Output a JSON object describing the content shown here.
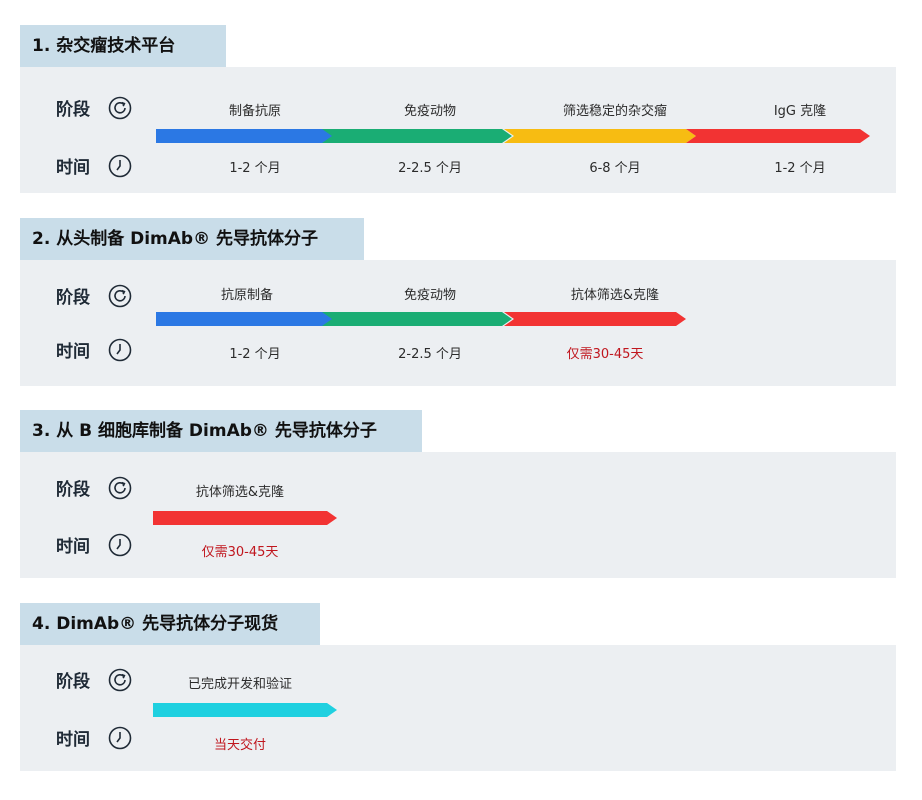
{
  "labels": {
    "stage": "阶段",
    "time": "时间"
  },
  "colors": {
    "blue": "#2b78e4",
    "green": "#1aad74",
    "yellow": "#f7bc12",
    "red": "#f23333",
    "cyan": "#1fd0e0",
    "highlight_text": "#c0161e"
  },
  "sections": [
    {
      "title": "1. 杂交瘤技术平台",
      "stages": [
        {
          "name": "制备抗原",
          "duration": "1-2 个月",
          "color": "blue"
        },
        {
          "name": "免疫动物",
          "duration": "2-2.5 个月",
          "color": "green"
        },
        {
          "name": "筛选稳定的杂交瘤",
          "duration": "6-8 个月",
          "color": "yellow"
        },
        {
          "name": "IgG 克隆",
          "duration": "1-2 个月",
          "color": "red"
        }
      ]
    },
    {
      "title": "2. 从头制备 DimAb® 先导抗体分子",
      "stages": [
        {
          "name": "抗原制备",
          "duration": "1-2 个月",
          "color": "blue"
        },
        {
          "name": "免疫动物",
          "duration": "2-2.5 个月",
          "color": "green"
        },
        {
          "name": "抗体筛选&克隆",
          "duration": "仅需30-45天",
          "color": "red",
          "highlight": true
        }
      ]
    },
    {
      "title": "3. 从 B 细胞库制备 DimAb® 先导抗体分子",
      "stages": [
        {
          "name": "抗体筛选&克隆",
          "duration": "仅需30-45天",
          "color": "red",
          "highlight": true
        }
      ]
    },
    {
      "title": "4. DimAb® 先导抗体分子现货",
      "stages": [
        {
          "name": "已完成开发和验证",
          "duration": "当天交付",
          "color": "cyan",
          "highlight": true
        }
      ]
    }
  ]
}
